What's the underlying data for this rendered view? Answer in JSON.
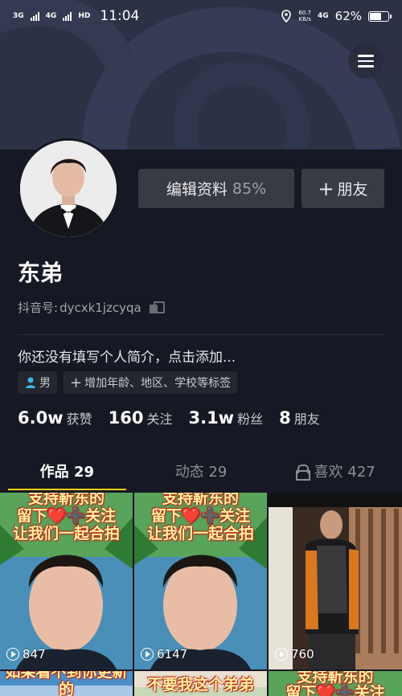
{
  "status_bar": {
    "network_1": "3G",
    "network_2": "4G",
    "hd_badge": "HD",
    "time": "11:04",
    "speed_value": "60.7",
    "speed_unit": "KB/s",
    "network_3": "4G",
    "battery_text": "62%",
    "battery_level": 0.62
  },
  "profile": {
    "name": "东弟",
    "id_label": "抖音号:",
    "id_value": "dycxk1jzcyqa",
    "bio": "你还没有填写个人简介，点击添加...",
    "gender_tag": "男",
    "add_tag": "增加年龄、地区、学校等标签",
    "edit_button": "编辑资料",
    "edit_percent": "85%",
    "friend_button": "朋友",
    "plus_symbol": "+"
  },
  "stats": [
    {
      "value": "6.0w",
      "label": "获赞"
    },
    {
      "value": "160",
      "label": "关注"
    },
    {
      "value": "3.1w",
      "label": "粉丝"
    },
    {
      "value": "8",
      "label": "朋友"
    }
  ],
  "tabs": [
    {
      "label": "作品 29",
      "active": true
    },
    {
      "label": "动态 29",
      "active": false
    },
    {
      "label": "喜欢 427",
      "active": false,
      "icon": "lock-icon"
    }
  ],
  "videos": [
    {
      "caption_1": "支持靳东的",
      "caption_2": "留下❤️➕关注",
      "caption_3": "让我们一起合拍",
      "plays": "847"
    },
    {
      "caption_1": "支持靳东的",
      "caption_2": "留下❤️➕关注",
      "caption_3": "让我们一起合拍",
      "plays": "6147"
    },
    {
      "plays": "760"
    },
    {
      "caption_1": "如果看不到你更新的"
    },
    {
      "caption_1": "不要我这个弟弟"
    },
    {
      "caption_1": "支持靳东的",
      "caption_2": "留下❤️➕关注"
    }
  ],
  "colors": {
    "background": "#161823",
    "accent": "#face15",
    "button": "#393b44"
  }
}
